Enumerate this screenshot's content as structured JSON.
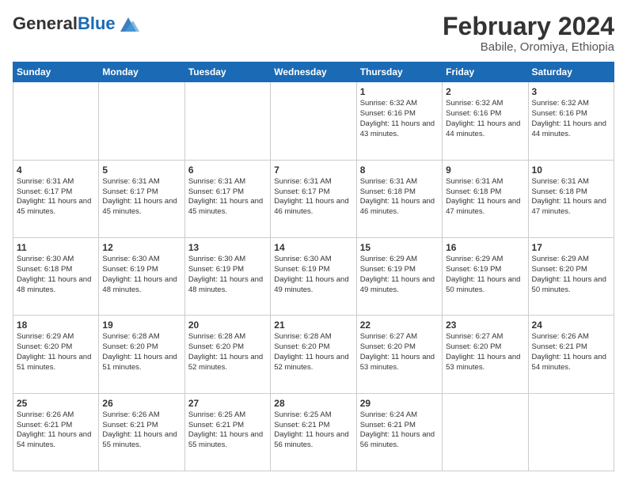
{
  "logo": {
    "general": "General",
    "blue": "Blue"
  },
  "header": {
    "month_year": "February 2024",
    "location": "Babile, Oromiya, Ethiopia"
  },
  "weekdays": [
    "Sunday",
    "Monday",
    "Tuesday",
    "Wednesday",
    "Thursday",
    "Friday",
    "Saturday"
  ],
  "weeks": [
    [
      {
        "day": "",
        "content": ""
      },
      {
        "day": "",
        "content": ""
      },
      {
        "day": "",
        "content": ""
      },
      {
        "day": "",
        "content": ""
      },
      {
        "day": "1",
        "content": "Sunrise: 6:32 AM\nSunset: 6:16 PM\nDaylight: 11 hours and 43 minutes."
      },
      {
        "day": "2",
        "content": "Sunrise: 6:32 AM\nSunset: 6:16 PM\nDaylight: 11 hours and 44 minutes."
      },
      {
        "day": "3",
        "content": "Sunrise: 6:32 AM\nSunset: 6:16 PM\nDaylight: 11 hours and 44 minutes."
      }
    ],
    [
      {
        "day": "4",
        "content": "Sunrise: 6:31 AM\nSunset: 6:17 PM\nDaylight: 11 hours and 45 minutes."
      },
      {
        "day": "5",
        "content": "Sunrise: 6:31 AM\nSunset: 6:17 PM\nDaylight: 11 hours and 45 minutes."
      },
      {
        "day": "6",
        "content": "Sunrise: 6:31 AM\nSunset: 6:17 PM\nDaylight: 11 hours and 45 minutes."
      },
      {
        "day": "7",
        "content": "Sunrise: 6:31 AM\nSunset: 6:17 PM\nDaylight: 11 hours and 46 minutes."
      },
      {
        "day": "8",
        "content": "Sunrise: 6:31 AM\nSunset: 6:18 PM\nDaylight: 11 hours and 46 minutes."
      },
      {
        "day": "9",
        "content": "Sunrise: 6:31 AM\nSunset: 6:18 PM\nDaylight: 11 hours and 47 minutes."
      },
      {
        "day": "10",
        "content": "Sunrise: 6:31 AM\nSunset: 6:18 PM\nDaylight: 11 hours and 47 minutes."
      }
    ],
    [
      {
        "day": "11",
        "content": "Sunrise: 6:30 AM\nSunset: 6:18 PM\nDaylight: 11 hours and 48 minutes."
      },
      {
        "day": "12",
        "content": "Sunrise: 6:30 AM\nSunset: 6:19 PM\nDaylight: 11 hours and 48 minutes."
      },
      {
        "day": "13",
        "content": "Sunrise: 6:30 AM\nSunset: 6:19 PM\nDaylight: 11 hours and 48 minutes."
      },
      {
        "day": "14",
        "content": "Sunrise: 6:30 AM\nSunset: 6:19 PM\nDaylight: 11 hours and 49 minutes."
      },
      {
        "day": "15",
        "content": "Sunrise: 6:29 AM\nSunset: 6:19 PM\nDaylight: 11 hours and 49 minutes."
      },
      {
        "day": "16",
        "content": "Sunrise: 6:29 AM\nSunset: 6:19 PM\nDaylight: 11 hours and 50 minutes."
      },
      {
        "day": "17",
        "content": "Sunrise: 6:29 AM\nSunset: 6:20 PM\nDaylight: 11 hours and 50 minutes."
      }
    ],
    [
      {
        "day": "18",
        "content": "Sunrise: 6:29 AM\nSunset: 6:20 PM\nDaylight: 11 hours and 51 minutes."
      },
      {
        "day": "19",
        "content": "Sunrise: 6:28 AM\nSunset: 6:20 PM\nDaylight: 11 hours and 51 minutes."
      },
      {
        "day": "20",
        "content": "Sunrise: 6:28 AM\nSunset: 6:20 PM\nDaylight: 11 hours and 52 minutes."
      },
      {
        "day": "21",
        "content": "Sunrise: 6:28 AM\nSunset: 6:20 PM\nDaylight: 11 hours and 52 minutes."
      },
      {
        "day": "22",
        "content": "Sunrise: 6:27 AM\nSunset: 6:20 PM\nDaylight: 11 hours and 53 minutes."
      },
      {
        "day": "23",
        "content": "Sunrise: 6:27 AM\nSunset: 6:20 PM\nDaylight: 11 hours and 53 minutes."
      },
      {
        "day": "24",
        "content": "Sunrise: 6:26 AM\nSunset: 6:21 PM\nDaylight: 11 hours and 54 minutes."
      }
    ],
    [
      {
        "day": "25",
        "content": "Sunrise: 6:26 AM\nSunset: 6:21 PM\nDaylight: 11 hours and 54 minutes."
      },
      {
        "day": "26",
        "content": "Sunrise: 6:26 AM\nSunset: 6:21 PM\nDaylight: 11 hours and 55 minutes."
      },
      {
        "day": "27",
        "content": "Sunrise: 6:25 AM\nSunset: 6:21 PM\nDaylight: 11 hours and 55 minutes."
      },
      {
        "day": "28",
        "content": "Sunrise: 6:25 AM\nSunset: 6:21 PM\nDaylight: 11 hours and 56 minutes."
      },
      {
        "day": "29",
        "content": "Sunrise: 6:24 AM\nSunset: 6:21 PM\nDaylight: 11 hours and 56 minutes."
      },
      {
        "day": "",
        "content": ""
      },
      {
        "day": "",
        "content": ""
      }
    ]
  ]
}
